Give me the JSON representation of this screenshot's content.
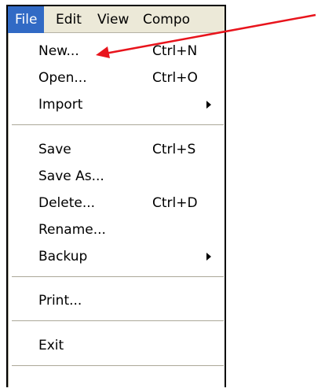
{
  "menubar": {
    "items": [
      {
        "label": "File"
      },
      {
        "label": "Edit"
      },
      {
        "label": "View"
      },
      {
        "label": "Compo"
      }
    ]
  },
  "file_menu": {
    "items": [
      {
        "label": "New...",
        "shortcut": "Ctrl+N"
      },
      {
        "label": "Open...",
        "shortcut": "Ctrl+O"
      },
      {
        "label": "Import",
        "shortcut": ""
      },
      {
        "label": "Save",
        "shortcut": "Ctrl+S"
      },
      {
        "label": "Save As...",
        "shortcut": ""
      },
      {
        "label": "Delete...",
        "shortcut": "Ctrl+D"
      },
      {
        "label": "Rename...",
        "shortcut": ""
      },
      {
        "label": "Backup",
        "shortcut": ""
      },
      {
        "label": "Print...",
        "shortcut": ""
      },
      {
        "label": "Exit",
        "shortcut": ""
      }
    ]
  },
  "colors": {
    "menubar_bg": "#ece9d8",
    "active_menu": "#316ac5",
    "annotation_arrow": "#e8141c"
  }
}
